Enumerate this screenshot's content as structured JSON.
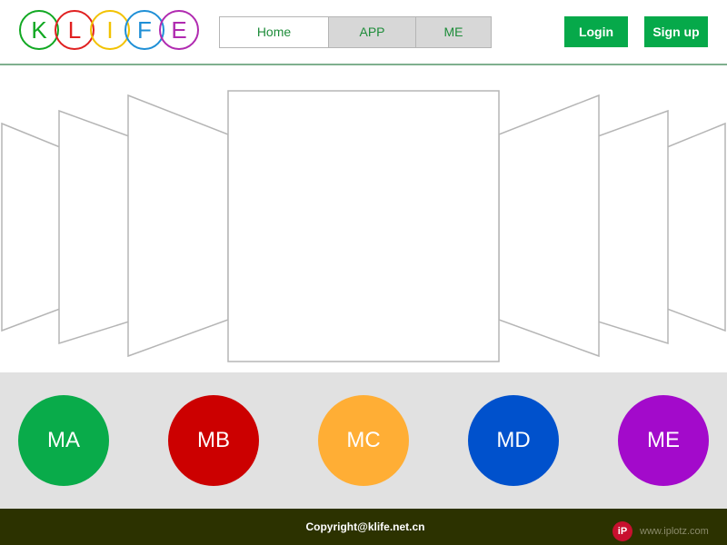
{
  "logo": {
    "letters": [
      {
        "char": "K",
        "color": "#11a822"
      },
      {
        "char": "L",
        "color": "#e02020"
      },
      {
        "char": "I",
        "color": "#f2c200"
      },
      {
        "char": "F",
        "color": "#1e8fd6"
      },
      {
        "char": "E",
        "color": "#b02ab0"
      }
    ]
  },
  "nav": {
    "tabs": [
      {
        "label": "Home",
        "active": true
      },
      {
        "label": "APP",
        "active": false
      },
      {
        "label": "ME",
        "active": false
      }
    ]
  },
  "auth": {
    "login_label": "Login",
    "signup_label": "Sign up",
    "color": "#06a94a"
  },
  "modules": [
    {
      "label": "MA",
      "color": "#09ab4a"
    },
    {
      "label": "MB",
      "color": "#cc0000"
    },
    {
      "label": "MC",
      "color": "#ffae35"
    },
    {
      "label": "MD",
      "color": "#0051cc"
    },
    {
      "label": "ME",
      "color": "#a30acb"
    }
  ],
  "footer": {
    "copyright": "Copyright@klife.net.cn",
    "watermark": "www.iplotz.com",
    "watermark_icon": "iP"
  }
}
